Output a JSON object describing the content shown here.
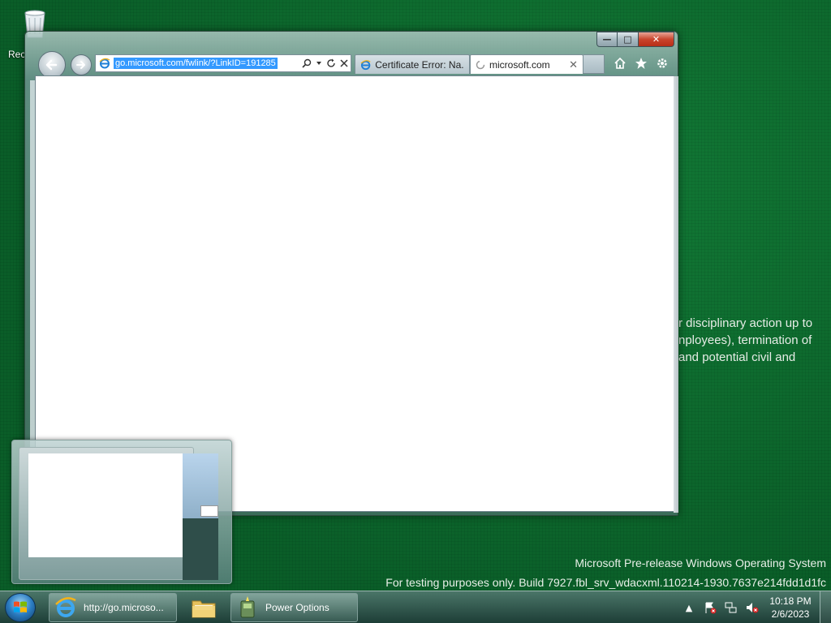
{
  "desktop": {
    "recycle_bin_label": "Rec",
    "background_text": [
      "r disciplinary action up to",
      "nployees), termination of",
      "and potential civil and"
    ],
    "watermark": {
      "line1": "Microsoft Pre-release Windows Operating System",
      "line2": "For testing purposes only. Build 7927.fbl_srv_wdacxml.110214-1930.7637e214fdd1d1fc"
    }
  },
  "browser": {
    "address": "go.microsoft.com/fwlink/?LinkID=191285",
    "tabs": [
      {
        "label": "Certificate Error: Na...",
        "active": false
      },
      {
        "label": "microsoft.com",
        "active": true
      }
    ],
    "window_buttons": {
      "minimize": "—",
      "maximize": "□",
      "close": "✕"
    }
  },
  "taskbar": {
    "buttons": [
      {
        "label": "http://go.microso..."
      },
      {
        "label": ""
      },
      {
        "label": "Power Options"
      }
    ],
    "clock": {
      "time": "10:18 PM",
      "date": "2/6/2023"
    }
  },
  "colors": {
    "desktop_bg": "#0c6b2e",
    "selection": "#3399ff",
    "close_button": "#c9452d"
  }
}
